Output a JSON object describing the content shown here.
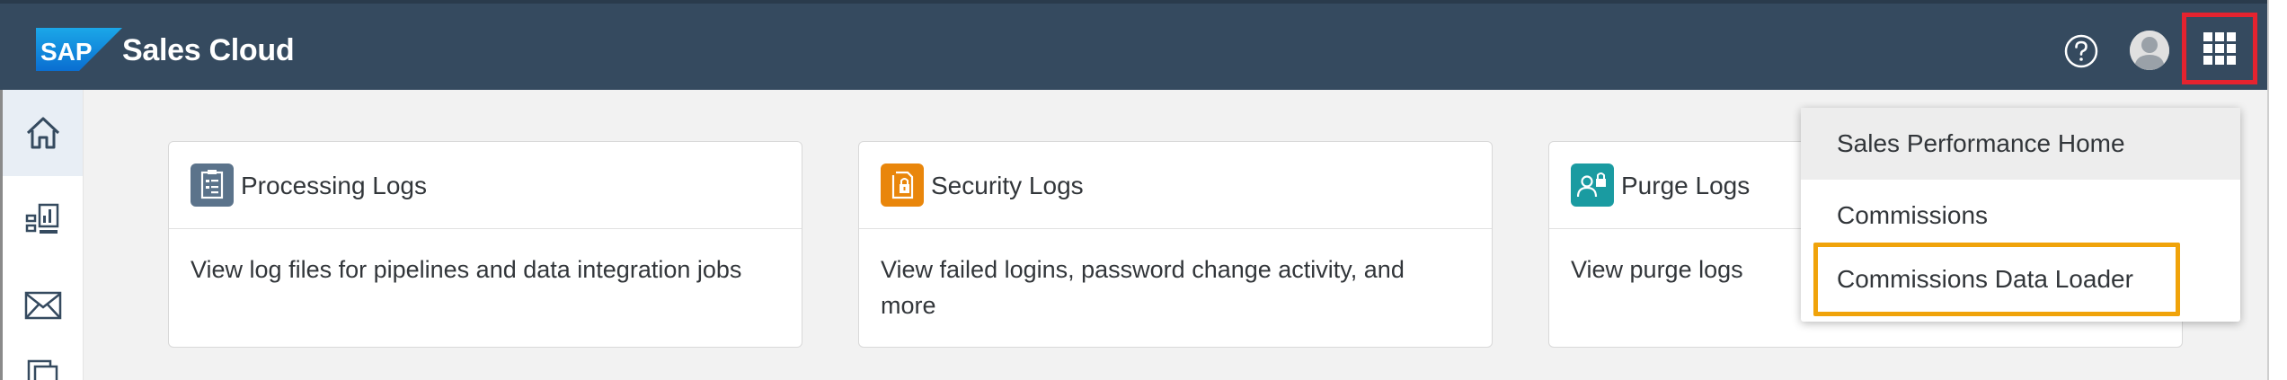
{
  "app": {
    "logo_text": "SAP",
    "product_name": "Sales Cloud"
  },
  "header": {
    "help_icon": "question-circle-icon",
    "avatar_icon": "user-avatar-icon",
    "launchpad_icon": "grid-icon",
    "launchpad_highlight_color": "#e5232f"
  },
  "sidenav": {
    "items": [
      {
        "icon": "home-icon",
        "active": true
      },
      {
        "icon": "analytics-icon"
      },
      {
        "icon": "mail-icon"
      },
      {
        "icon": "document-icon"
      }
    ]
  },
  "cards": [
    {
      "title": "Processing Logs",
      "description": "View log files for pipelines and data integration jobs",
      "icon": "log-document-icon",
      "icon_color": "#5b738b"
    },
    {
      "title": "Security Logs",
      "description": "View failed logins, password change activity, and more",
      "icon": "lock-document-icon",
      "icon_color": "#e9860b"
    },
    {
      "title": "Purge Logs",
      "description": "View purge logs",
      "icon": "user-lock-icon",
      "icon_color": "#1a9ba1"
    }
  ],
  "menu": {
    "items": [
      {
        "label": "Sales Performance Home"
      },
      {
        "label": "Commissions"
      },
      {
        "label": "Commissions Data Loader"
      }
    ],
    "highlight_color": "#f0a30a"
  }
}
